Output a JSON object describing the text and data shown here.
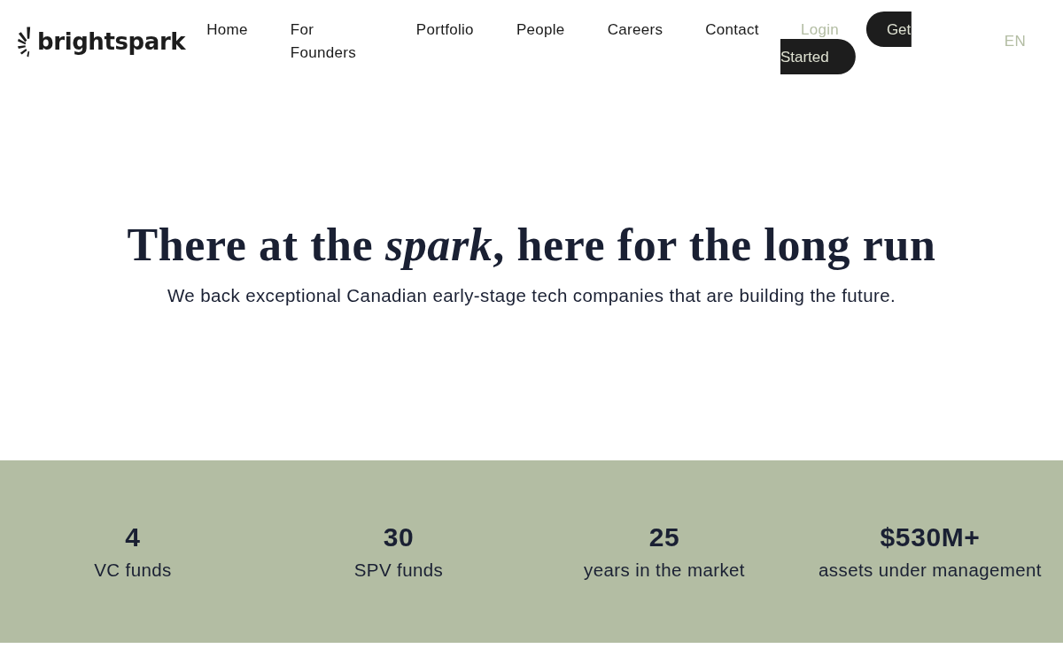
{
  "header": {
    "logo": "brightspark",
    "nav": [
      "Home",
      "For Founders",
      "Portfolio",
      "People",
      "Careers",
      "Contact"
    ],
    "login": "Login",
    "cta": "Get Started",
    "language": {
      "label": "EN",
      "selected": true
    }
  },
  "hero": {
    "title": "There at the *spark*, here for the long run",
    "subtitle": "We back exceptional Canadian early-stage tech companies that are building the future."
  },
  "stats": [
    {
      "value": "4",
      "label": "VC funds"
    },
    {
      "value": "30",
      "label": "SPV funds"
    },
    {
      "value": "25",
      "label": "years in the market"
    },
    {
      "value": "$530M+",
      "label": "assets under management"
    }
  ]
}
